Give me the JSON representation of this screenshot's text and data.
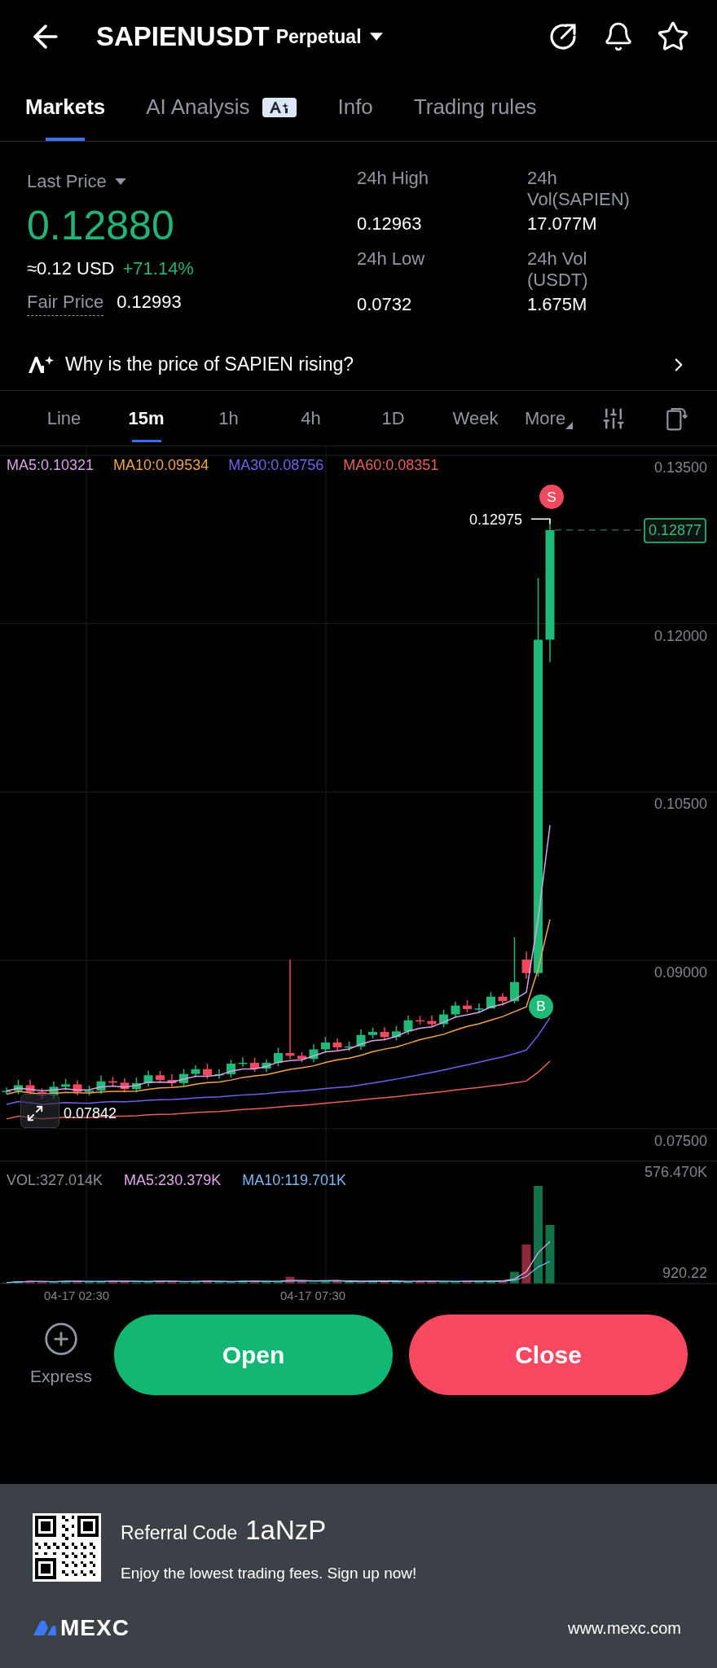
{
  "header": {
    "title": "SAPIENUSDT",
    "subtitle": "Perpetual"
  },
  "tabs": [
    {
      "label": "Markets",
      "selected": true,
      "badge": false
    },
    {
      "label": "AI Analysis",
      "selected": false,
      "badge": true
    },
    {
      "label": "Info",
      "selected": false,
      "badge": false
    },
    {
      "label": "Trading rules",
      "selected": false,
      "badge": false
    }
  ],
  "summary": {
    "last_price_label": "Last Price",
    "price": "0.12880",
    "usd": "≈0.12 USD",
    "change": "+71.14%",
    "fair_price_label": "Fair Price",
    "fair_price": "0.12993"
  },
  "stats": [
    {
      "label": "24h High",
      "value": "0.12963"
    },
    {
      "label": "24h Vol(SAPIEN)",
      "value": "17.077M"
    },
    {
      "label": "24h Low",
      "value": "0.0732"
    },
    {
      "label": "24h Vol (USDT)",
      "value": "1.675M"
    }
  ],
  "insight": "Why is the price of SAPIEN rising?",
  "intervals": [
    {
      "label": "Line",
      "selected": false
    },
    {
      "label": "15m",
      "selected": true
    },
    {
      "label": "1h",
      "selected": false
    },
    {
      "label": "4h",
      "selected": false
    },
    {
      "label": "1D",
      "selected": false
    },
    {
      "label": "Week",
      "selected": false
    },
    {
      "label": "More",
      "selected": false
    }
  ],
  "ma_legend": [
    {
      "label": "MA5:0.10321",
      "color": "#d7a2e6"
    },
    {
      "label": "MA10:0.09534",
      "color": "#f2a44c"
    },
    {
      "label": "MA30:0.08756",
      "color": "#6e62f0"
    },
    {
      "label": "MA60:0.08351",
      "color": "#e8605c"
    }
  ],
  "price_axis": [
    "0.13500",
    "0.12000",
    "0.10500",
    "0.09000",
    "0.07500"
  ],
  "chart": {
    "high_label": "0.12975",
    "current_price": "0.12877",
    "low_label": "0.07842",
    "sell_marker": "S",
    "buy_marker": "B"
  },
  "volume_legend": [
    {
      "label": "VOL:327.014K",
      "color": "#8a8f98"
    },
    {
      "label": "MA5:230.379K",
      "color": "#e4a6ee"
    },
    {
      "label": "MA10:119.701K",
      "color": "#7db8f0"
    }
  ],
  "volume_axis": [
    "576.470K",
    "920.22"
  ],
  "time_labels": [
    "04-17 02:30",
    "04-17 07:30"
  ],
  "actions": {
    "express": "Express",
    "open": "Open",
    "close": "Close"
  },
  "banner": {
    "referral_label": "Referral Code",
    "code": "1aNzP",
    "tagline": "Enjoy the lowest trading fees. Sign up now!",
    "logo": "MEXC",
    "url": "www.mexc.com"
  }
}
